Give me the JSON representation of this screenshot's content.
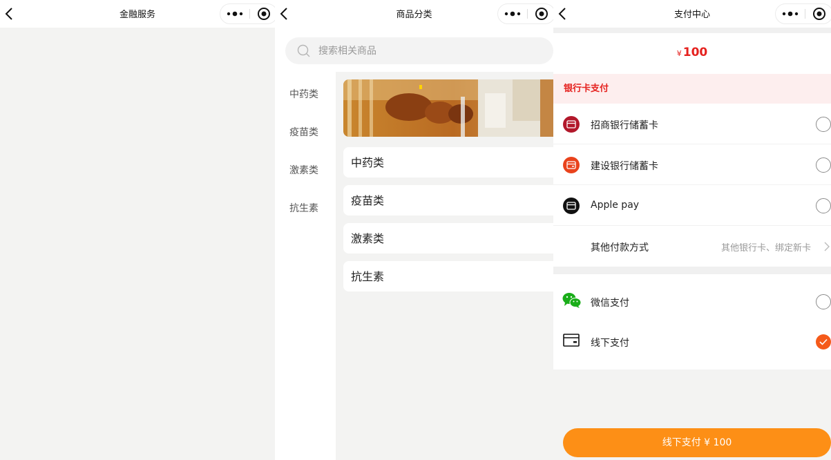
{
  "screens": {
    "finance": {
      "title": "金融服务"
    },
    "category": {
      "title": "商品分类",
      "search": {
        "placeholder": "搜索相关商品"
      },
      "sidebar": [
        "中药类",
        "疫苗类",
        "激素类",
        "抗生素"
      ],
      "cards": [
        "中药类",
        "疫苗类",
        "激素类",
        "抗生素"
      ]
    },
    "payment": {
      "title": "支付中心",
      "currency": "¥",
      "amount": "100",
      "bank_section": "银行卡支付",
      "methods": {
        "cmb": "招商银行储蓄卡",
        "ccb": "建设银行储蓄卡",
        "apple": "Apple pay",
        "other": "其他付款方式",
        "other_hint": "其他银行卡、绑定新卡",
        "wechat": "微信支付",
        "offline": "线下支付"
      },
      "selected_method": "线下支付",
      "pay_button": "线下支付 ¥ 100"
    }
  },
  "colors": {
    "accent_red": "#e5211e",
    "orange_button": "#fd8f16",
    "check_orange": "#f55a1a",
    "cmb_red": "#b2182b",
    "ccb_orange": "#e9431c",
    "wechat_green": "#1aad19"
  },
  "icons": [
    "back-icon",
    "more-dots-icon",
    "close-circle-icon",
    "search-icon",
    "card-icon",
    "wechat-icon",
    "chevron-right-icon",
    "check-icon"
  ]
}
